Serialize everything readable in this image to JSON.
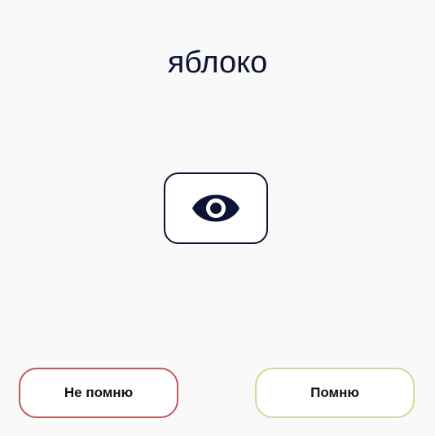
{
  "card": {
    "word": "яблоко",
    "reveal_icon": "eye-icon"
  },
  "actions": {
    "forgot_label": "Не помню",
    "remember_label": "Помню"
  },
  "colors": {
    "background": "#f9f9f9",
    "text": "#0d1333",
    "forgot_border": "#c0585e",
    "remember_border": "#c6df9a"
  }
}
